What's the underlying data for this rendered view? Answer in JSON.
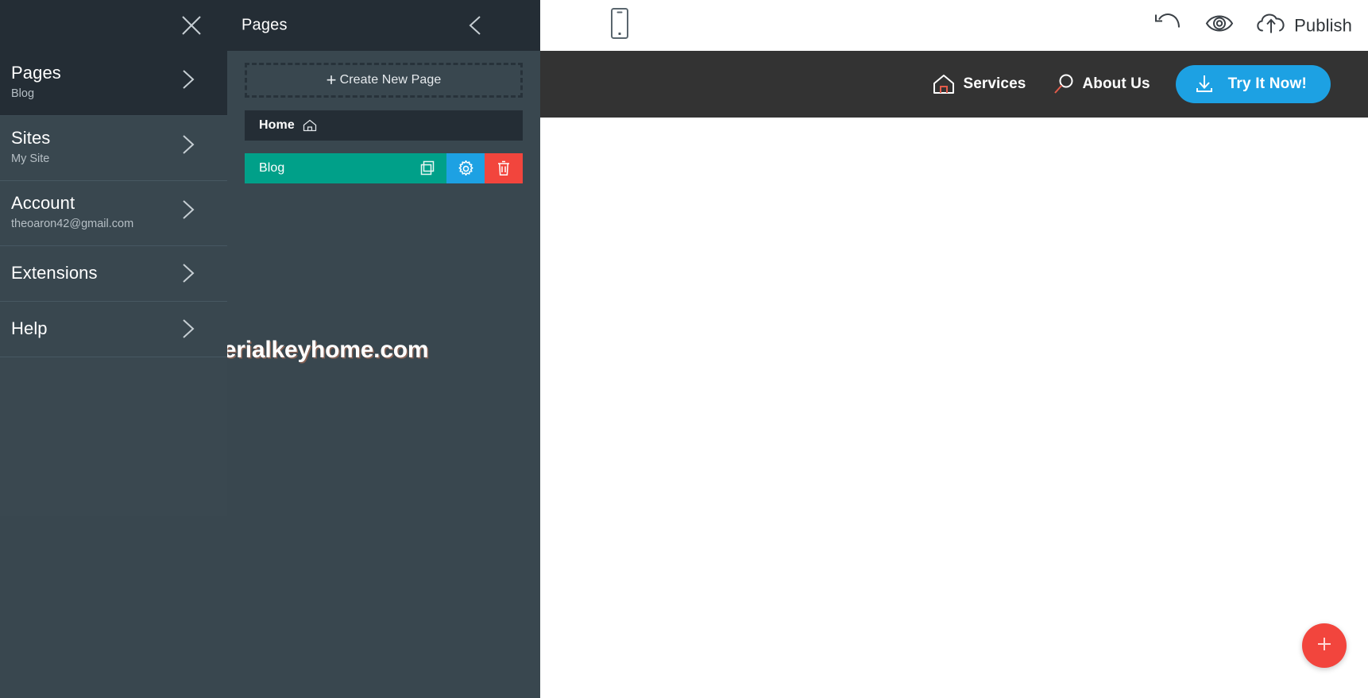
{
  "sidebar": {
    "close_icon": "close-icon",
    "items": [
      {
        "title": "Pages",
        "subtitle": "Blog",
        "active": true,
        "icon": "chevron-right-icon"
      },
      {
        "title": "Sites",
        "subtitle": "My Site",
        "active": false,
        "icon": "chevron-right-icon"
      },
      {
        "title": "Account",
        "subtitle": "theoaron42@gmail.com",
        "active": false,
        "icon": "chevron-right-icon"
      },
      {
        "title": "Extensions",
        "subtitle": "",
        "active": false,
        "icon": "chevron-right-icon"
      },
      {
        "title": "Help",
        "subtitle": "",
        "active": false,
        "icon": "chevron-right-icon"
      }
    ]
  },
  "pages_panel": {
    "header_title": "Pages",
    "collapse_icon": "chevron-left-icon",
    "create_new_label": "Create New Page",
    "create_new_plus": "+",
    "rows": [
      {
        "label": "Home",
        "selected": false,
        "icon": "home-icon"
      },
      {
        "label": "Blog",
        "selected": true,
        "actions": [
          {
            "name": "duplicate-page-button",
            "icon": "copy-icon",
            "color": "#00a089"
          },
          {
            "name": "page-settings-button",
            "icon": "gear-icon",
            "color": "#1da1e3"
          },
          {
            "name": "delete-page-button",
            "icon": "trash-icon",
            "color": "#f2453d"
          }
        ]
      }
    ],
    "watermark": "Serialkeyhome.com"
  },
  "toolbar": {
    "device_icon": "mobile-device-icon",
    "undo_icon": "undo-icon",
    "preview_icon": "eye-icon",
    "publish_icon": "cloud-upload-icon",
    "publish_label": "Publish"
  },
  "site_preview": {
    "nav": [
      {
        "label": "Services",
        "icon": "home-outline-icon"
      },
      {
        "label": "About Us",
        "icon": "search-icon"
      }
    ],
    "cta": {
      "label": "Try It Now!",
      "icon": "download-icon"
    },
    "add_block_icon": "plus-icon"
  },
  "colors": {
    "sidebar_bg": "#39474f",
    "sidebar_header_bg": "#242d35",
    "panel_bg": "#39474f",
    "selected_green": "#00a089",
    "accent_blue": "#1da1e3",
    "danger_red": "#f2453d",
    "site_nav_bg": "#333333"
  }
}
